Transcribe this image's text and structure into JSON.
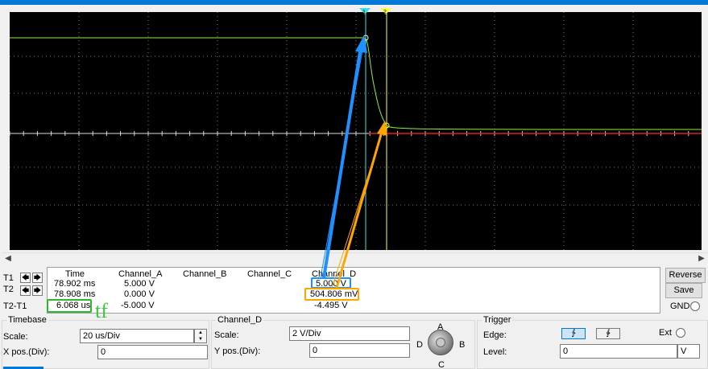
{
  "cursor_markers": {
    "t1": "1",
    "t2": "2"
  },
  "cursor_table": {
    "row_labels": [
      "T1",
      "T2",
      "T2-T1"
    ],
    "headers": {
      "time": "Time",
      "a": "Channel_A",
      "b": "Channel_B",
      "c": "Channel_C",
      "d": "Channel_D"
    },
    "time": [
      "78.902 ms",
      "78.908 ms",
      "6.068 us"
    ],
    "channel_a": [
      "5.000 V",
      "0.000 V",
      "-5.000 V"
    ],
    "channel_d": [
      "5.000 V",
      "504.806 mV",
      "-4.495 V"
    ]
  },
  "annotation": {
    "tf": "tf"
  },
  "buttons": {
    "reverse": "Reverse",
    "save": "Save",
    "gnd": "GND"
  },
  "timebase": {
    "title": "Timebase",
    "scale_label": "Scale:",
    "scale_value": "20 us/Div",
    "xpos_label": "X pos.(Div):",
    "xpos_value": "0"
  },
  "channel_d_panel": {
    "title": "Channel_D",
    "scale_label": "Scale:",
    "scale_value": "2  V/Div",
    "ypos_label": "Y pos.(Div):",
    "ypos_value": "0",
    "knob_labels": {
      "a": "A",
      "b": "B",
      "c": "C",
      "d": "D"
    }
  },
  "trigger": {
    "title": "Trigger",
    "edge_label": "Edge:",
    "ext_label": "Ext",
    "level_label": "Level:",
    "level_value": "0",
    "level_unit": "V",
    "edge_rising": "∱",
    "edge_falling": "∲"
  },
  "colors": {
    "trace": "#90ee40",
    "cursor1": "#40e0e0",
    "cursor2": "#ffff40",
    "red_trace": "#e02020",
    "highlight_blue": "#1e90ff",
    "highlight_orange": "#ffa500",
    "highlight_green": "#2db82d"
  }
}
